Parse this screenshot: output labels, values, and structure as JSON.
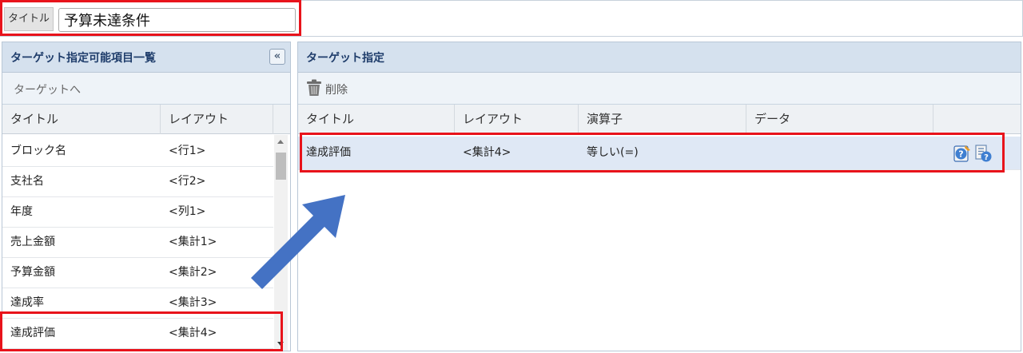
{
  "title_bar": {
    "label": "タイトル",
    "value": "予算未達条件"
  },
  "left_panel": {
    "title": "ターゲット指定可能項目一覧",
    "collapse_glyph": "«",
    "toolbar_label": "ターゲットへ",
    "columns": [
      "タイトル",
      "レイアウト"
    ],
    "rows": [
      {
        "title": "ブロック名",
        "layout": "<行1>"
      },
      {
        "title": "支社名",
        "layout": "<行2>"
      },
      {
        "title": "年度",
        "layout": "<列1>"
      },
      {
        "title": "売上金額",
        "layout": "<集計1>"
      },
      {
        "title": "予算金額",
        "layout": "<集計2>"
      },
      {
        "title": "達成率",
        "layout": "<集計3>"
      },
      {
        "title": "達成評価",
        "layout": "<集計4>"
      }
    ]
  },
  "right_panel": {
    "title": "ターゲット指定",
    "delete_label": "削除",
    "columns": [
      "タイトル",
      "レイアウト",
      "演算子",
      "データ"
    ],
    "rows": [
      {
        "title": "達成評価",
        "layout": "<集計4>",
        "operator": "等しい(=)",
        "data": ""
      }
    ]
  },
  "colors": {
    "highlight": "#e8131b",
    "arrow": "#4472c4",
    "header_bg": "#d5e1ee",
    "header_text": "#1f3d6b"
  },
  "icons": [
    "trash-icon",
    "edit-help-icon",
    "list-help-icon",
    "double-chevron-left-icon",
    "arrow-icon"
  ]
}
